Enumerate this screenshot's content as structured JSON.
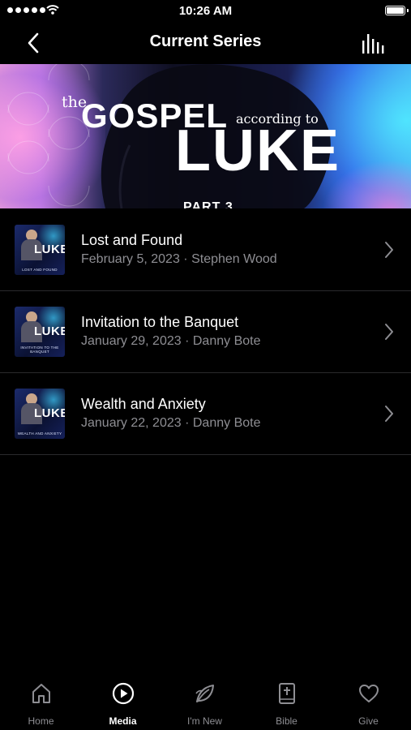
{
  "status_bar": {
    "time": "10:26 AM"
  },
  "nav": {
    "title": "Current Series"
  },
  "banner": {
    "the": "the",
    "gospel": "GOSPEL",
    "according": "according to",
    "luke": "LUKE",
    "part": "PART 3"
  },
  "sermons": [
    {
      "title": "Lost and Found",
      "subtitle": "February 5, 2023 · Stephen Wood",
      "thumb_caption": "LOST AND FOUND"
    },
    {
      "title": "Invitation to the Banquet",
      "subtitle": "January 29, 2023 · Danny Bote",
      "thumb_caption": "INVITATION TO THE BANQUET"
    },
    {
      "title": "Wealth and Anxiety",
      "subtitle": "January 22, 2023 · Danny Bote",
      "thumb_caption": "WEALTH AND ANXIETY"
    }
  ],
  "thumb_word": "LUKE",
  "tabs": [
    {
      "label": "Home",
      "icon": "home-icon"
    },
    {
      "label": "Media",
      "icon": "play-circle-icon",
      "active": true
    },
    {
      "label": "I'm New",
      "icon": "leaf-icon"
    },
    {
      "label": "Bible",
      "icon": "bible-icon"
    },
    {
      "label": "Give",
      "icon": "heart-icon"
    }
  ],
  "colors": {
    "background": "#000000",
    "secondary_text": "#8e8e93",
    "divider": "#2a2a2c"
  }
}
